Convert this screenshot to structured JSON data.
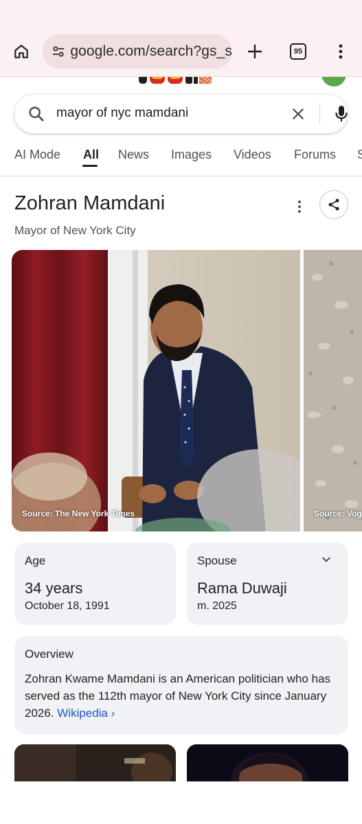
{
  "browser": {
    "url": "google.com/search?gs_s",
    "tab_count": "95",
    "icons": [
      "home-icon",
      "tune-icon",
      "plus-icon",
      "tab-switcher-icon",
      "more-vert-icon"
    ]
  },
  "search": {
    "query": "mayor of nyc mamdani"
  },
  "tabs": [
    {
      "label": "AI Mode"
    },
    {
      "label": "All"
    },
    {
      "label": "News"
    },
    {
      "label": "Images"
    },
    {
      "label": "Videos"
    },
    {
      "label": "Forums"
    },
    {
      "label": "S"
    }
  ],
  "active_tab": "All",
  "knowledge_panel": {
    "title": "Zohran Mamdani",
    "subtitle": "Mayor of New York City",
    "images": [
      {
        "source": "Source: The New York Times"
      },
      {
        "source": "Source: Vog"
      }
    ],
    "facts": {
      "age": {
        "label": "Age",
        "value": "34 years",
        "sub": "October 18, 1991"
      },
      "spouse": {
        "label": "Spouse",
        "value": "Rama Duwaji",
        "sub": "m. 2025"
      }
    },
    "overview": {
      "label": "Overview",
      "text": "Zohran Kwame Mamdani is an American politician who has served as the 112th mayor of New York City since January 2026. ",
      "link": "Wikipedia ›"
    }
  },
  "colors": {
    "chrome_bg": "#fbf1f2",
    "omnibox_bg": "#f1dfe1",
    "card_bg": "#f0f2f5",
    "link": "#1a57c9"
  }
}
